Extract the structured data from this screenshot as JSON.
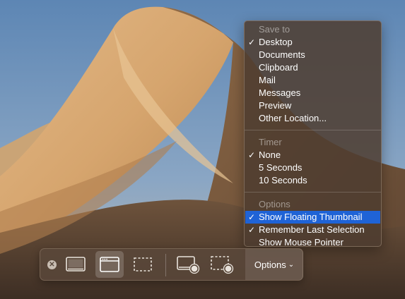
{
  "menu": {
    "sections": [
      {
        "header": "Save to",
        "items": [
          {
            "label": "Desktop",
            "checked": true
          },
          {
            "label": "Documents",
            "checked": false
          },
          {
            "label": "Clipboard",
            "checked": false
          },
          {
            "label": "Mail",
            "checked": false
          },
          {
            "label": "Messages",
            "checked": false
          },
          {
            "label": "Preview",
            "checked": false
          },
          {
            "label": "Other Location...",
            "checked": false
          }
        ]
      },
      {
        "header": "Timer",
        "items": [
          {
            "label": "None",
            "checked": true
          },
          {
            "label": "5 Seconds",
            "checked": false
          },
          {
            "label": "10 Seconds",
            "checked": false
          }
        ]
      },
      {
        "header": "Options",
        "items": [
          {
            "label": "Show Floating Thumbnail",
            "checked": true,
            "highlighted": true
          },
          {
            "label": "Remember Last Selection",
            "checked": true
          },
          {
            "label": "Show Mouse Pointer",
            "checked": false
          }
        ]
      }
    ],
    "checkmark": "✓",
    "highlight_color": "#1f63d6"
  },
  "toolbar": {
    "close_glyph": "✕",
    "buttons": [
      {
        "name": "capture-entire-screen",
        "icon": "screen-icon",
        "selected": false
      },
      {
        "name": "capture-selected-window",
        "icon": "window-icon",
        "selected": true
      },
      {
        "name": "capture-selected-portion",
        "icon": "dashed-rect-icon",
        "selected": false
      },
      {
        "name": "record-entire-screen",
        "icon": "screen-record-icon",
        "selected": false
      },
      {
        "name": "record-selected-portion",
        "icon": "dashed-record-icon",
        "selected": false
      }
    ],
    "options_label": "Options",
    "options_chevron": "⌄"
  }
}
